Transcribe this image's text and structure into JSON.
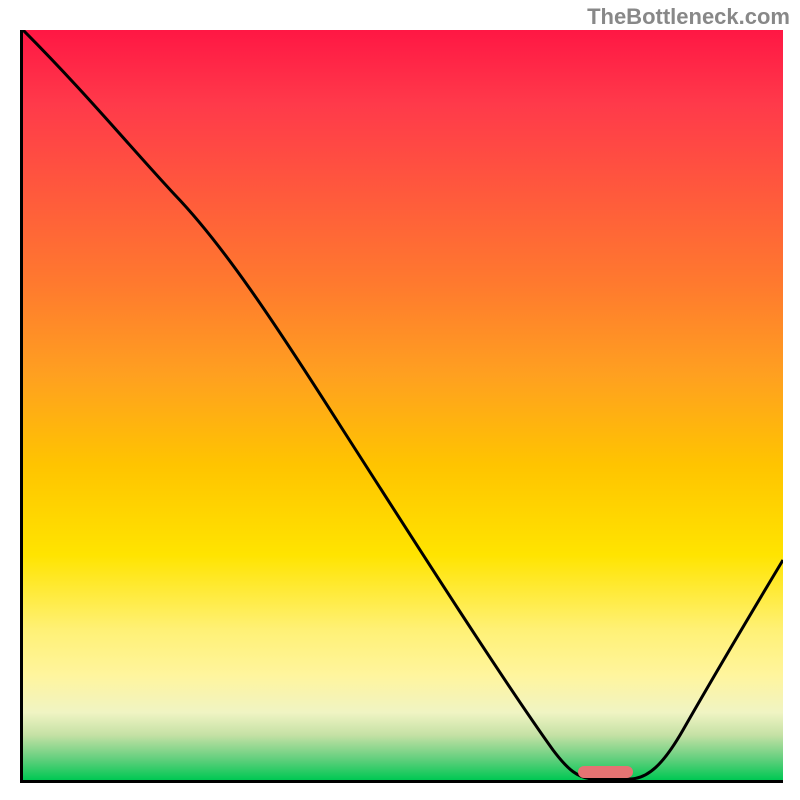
{
  "watermark": "TheBottleneck.com",
  "chart_data": {
    "type": "line",
    "title": "",
    "xlabel": "",
    "ylabel": "",
    "xlim": [
      0,
      100
    ],
    "ylim": [
      0,
      100
    ],
    "x": [
      0,
      20,
      72,
      80,
      100
    ],
    "values": [
      100,
      78,
      0,
      0,
      28
    ],
    "marker": {
      "x_start": 72,
      "x_end": 80,
      "y": 0
    },
    "gradient_stops": [
      {
        "pos": 0,
        "color": "#ff1744"
      },
      {
        "pos": 10,
        "color": "#ff3a4a"
      },
      {
        "pos": 22,
        "color": "#ff5a3c"
      },
      {
        "pos": 34,
        "color": "#ff7a2e"
      },
      {
        "pos": 46,
        "color": "#ffa020"
      },
      {
        "pos": 58,
        "color": "#ffc400"
      },
      {
        "pos": 70,
        "color": "#ffe400"
      },
      {
        "pos": 80,
        "color": "#fff176"
      },
      {
        "pos": 86,
        "color": "#fff59d"
      },
      {
        "pos": 91,
        "color": "#f0f4c3"
      },
      {
        "pos": 94,
        "color": "#c5e1a5"
      },
      {
        "pos": 97,
        "color": "#69d080"
      },
      {
        "pos": 100,
        "color": "#00c853"
      }
    ]
  }
}
